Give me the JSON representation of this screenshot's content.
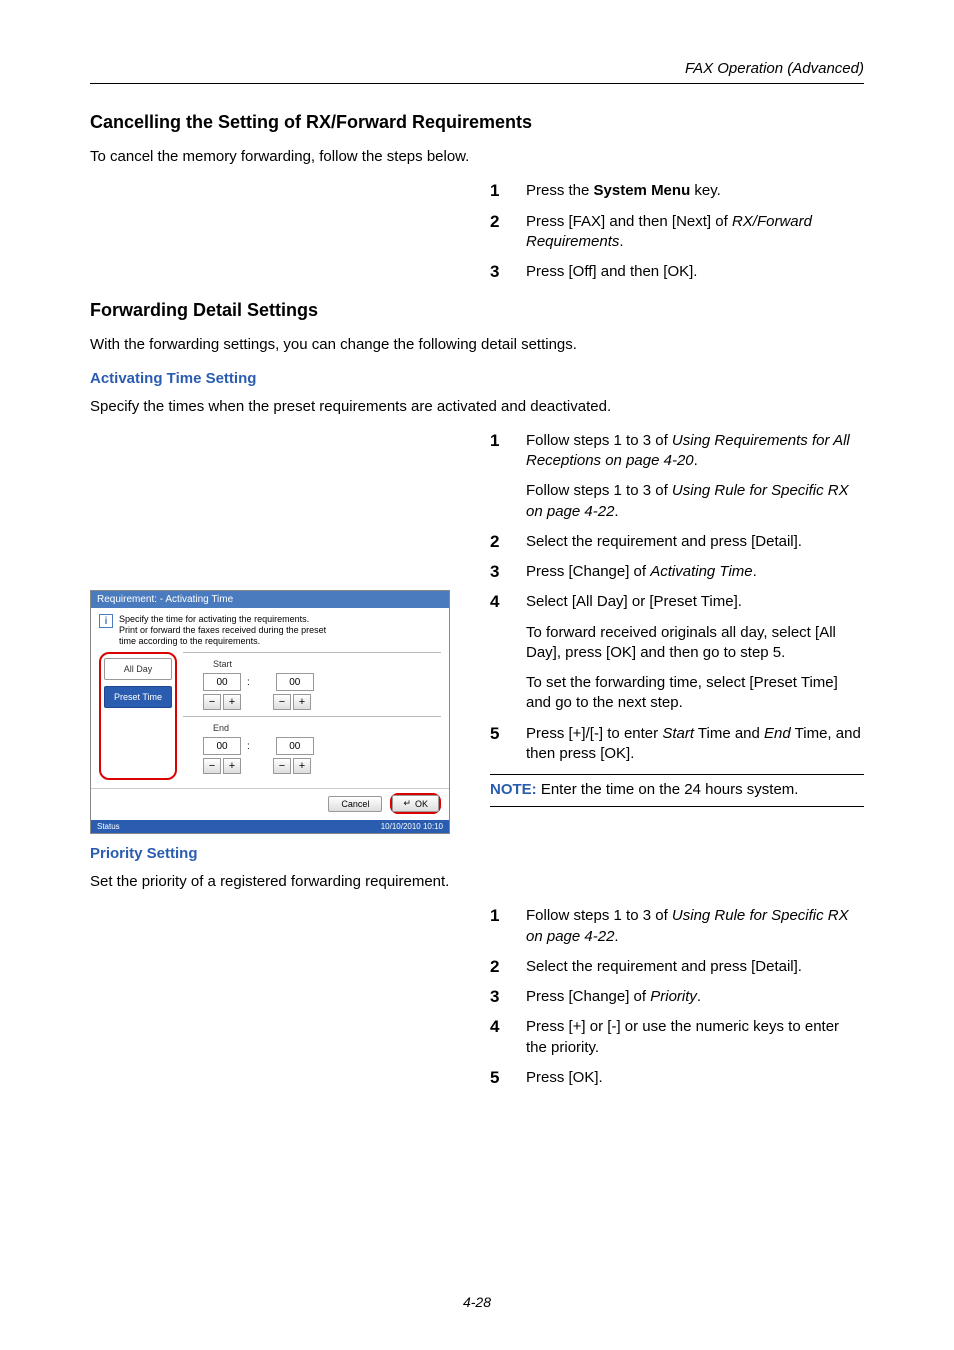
{
  "header": {
    "section_title": "FAX Operation (Advanced)"
  },
  "sect1": {
    "title": "Cancelling the Setting of RX/Forward Requirements",
    "intro": "To cancel the memory forwarding, follow the steps below.",
    "steps": [
      {
        "n": "1",
        "pre": "Press the ",
        "bold": "System Menu",
        "post": " key."
      },
      {
        "n": "2",
        "pre": "Press [FAX] and then [Next] of ",
        "italic": "RX/Forward Requirements",
        "post": "."
      },
      {
        "n": "3",
        "text": "Press [Off] and then [OK]."
      }
    ]
  },
  "sect2": {
    "title": "Forwarding Detail Settings",
    "intro": "With the forwarding settings, you can change the following detail settings."
  },
  "activating": {
    "heading": "Activating Time Setting",
    "intro": "Specify the times when the preset requirements are activated and deactivated.",
    "steps": {
      "s1": {
        "n": "1",
        "pre": "Follow steps 1 to 3 of ",
        "italic": "Using Requirements for All Receptions on page 4-20",
        "post": ".",
        "sub_pre": "Follow steps 1 to 3 of ",
        "sub_italic": "Using Rule for Specific RX on page 4-22",
        "sub_post": "."
      },
      "s2": {
        "n": "2",
        "text": "Select the requirement and press [Detail]."
      },
      "s3": {
        "n": "3",
        "pre": "Press [Change] of ",
        "italic": "Activating Time",
        "post": "."
      },
      "s4": {
        "n": "4",
        "text": "Select [All Day] or [Preset Time].",
        "sub1": "To forward received originals all day, select [All Day], press [OK] and then go to step 5.",
        "sub2": "To set the forwarding time, select [Preset Time] and go to the next step."
      },
      "s5": {
        "n": "5",
        "pre": "Press [+]/[-] to enter ",
        "italic1": "Start",
        "mid": " Time and ",
        "italic2": "End",
        "post": " Time, and then press [OK]."
      }
    },
    "note_label": "NOTE:",
    "note_text": " Enter the time on the 24 hours system."
  },
  "priority": {
    "heading": "Priority Setting",
    "intro": "Set the priority of a registered forwarding requirement.",
    "steps": {
      "s1": {
        "n": "1",
        "pre": "Follow steps 1 to 3 of ",
        "italic": "Using Rule for Specific RX on page 4-22",
        "post": "."
      },
      "s2": {
        "n": "2",
        "text": "Select the requirement and press [Detail]."
      },
      "s3": {
        "n": "3",
        "pre": "Press [Change] of ",
        "italic": "Priority",
        "post": "."
      },
      "s4": {
        "n": "4",
        "text": "Press [+] or [-] or use the numeric keys to enter the priority."
      },
      "s5": {
        "n": "5",
        "text": "Press [OK]."
      }
    }
  },
  "panel": {
    "title": "Requirement:    - Activating Time",
    "info": "Specify the time for activating the requirements.\nPrint or forward the faxes received during the preset\ntime according to the requirements.",
    "all_day": "All Day",
    "preset_time": "Preset Time",
    "start": "Start",
    "end": "End",
    "val": "00",
    "cancel": "Cancel",
    "ok": "OK",
    "status": "Status",
    "timestamp": "10/10/2010   10:10"
  },
  "footer": {
    "page": "4-28"
  }
}
